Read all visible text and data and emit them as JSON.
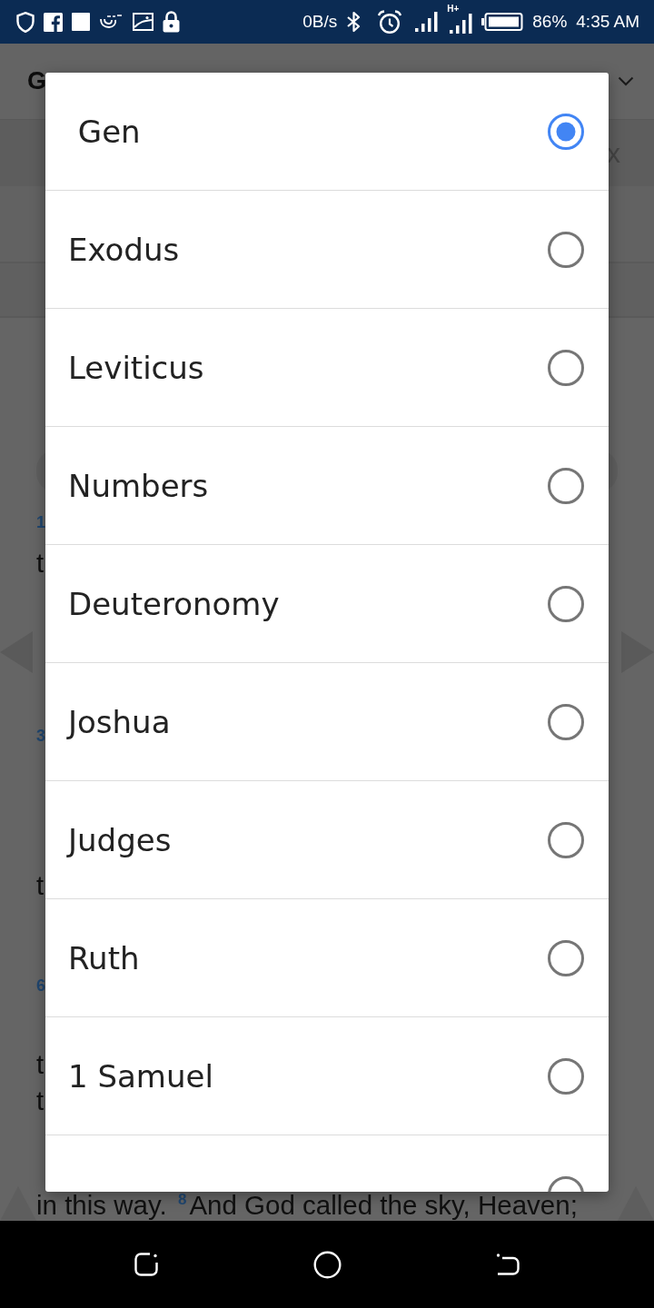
{
  "status_bar": {
    "network_speed": "0B/s",
    "network_type": "H+",
    "battery_percent": "86%",
    "time": "4:35 AM"
  },
  "background_page": {
    "header": {
      "title": "G"
    },
    "toolbar": {
      "text": "x"
    },
    "verses": [
      {
        "number": "1",
        "lines": [
          "t"
        ]
      },
      {
        "number": "3",
        "lines": [
          "t"
        ]
      },
      {
        "number": "6",
        "lines": [
          "t",
          "t",
          "in this way. $^{8}$And God called the sky, Heaven;"
        ]
      }
    ]
  },
  "book_dialog": {
    "books": [
      {
        "name": " Gen",
        "selected": true
      },
      {
        "name": "Exodus",
        "selected": false
      },
      {
        "name": "Leviticus",
        "selected": false
      },
      {
        "name": "Numbers",
        "selected": false
      },
      {
        "name": "Deuteronomy",
        "selected": false
      },
      {
        "name": "Joshua",
        "selected": false
      },
      {
        "name": "Judges",
        "selected": false
      },
      {
        "name": "Ruth",
        "selected": false
      },
      {
        "name": "1 Samuel",
        "selected": false
      },
      {
        "selected": false
      }
    ]
  }
}
